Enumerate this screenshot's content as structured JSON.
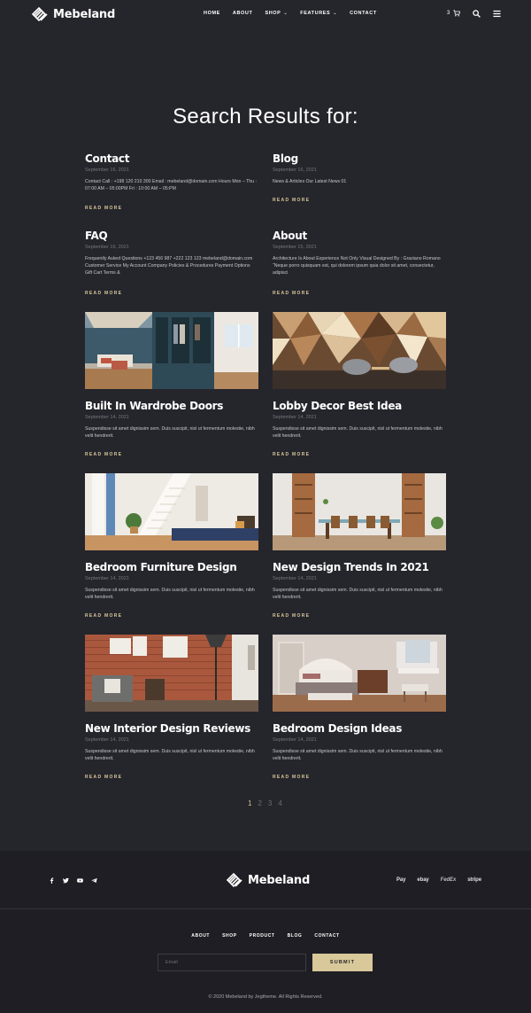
{
  "brand": {
    "name": "Mebeland"
  },
  "nav": {
    "items": [
      {
        "label": "HOME"
      },
      {
        "label": "ABOUT"
      },
      {
        "label": "SHOP",
        "dropdown": true
      },
      {
        "label": "FEATURES",
        "dropdown": true
      },
      {
        "label": "CONTACT"
      }
    ],
    "cart_count": "3"
  },
  "page": {
    "title": "Search Results for:"
  },
  "read_more_label": "READ MORE",
  "posts": [
    {
      "title": "Contact",
      "date": "September 16, 2021",
      "excerpt": "Contact Call : +198 120 210 300 Email : mebeland@domain.com Hours Mon – Thu : 07:00 AM – 05:00PM Fri : 10:00 AM – 05:PM"
    },
    {
      "title": "Blog",
      "date": "September 16, 2021",
      "excerpt": "News & Articles Our Latest News 01"
    },
    {
      "title": "FAQ",
      "date": "September 16, 2021",
      "excerpt": "Frequently Asked Questions +123 456 987 +222 123 123 mebeland@domain.com Customer Service My Account Company Policies & Procedures Payment Options Gift Cart Terms &"
    },
    {
      "title": "About",
      "date": "September 15, 2021",
      "excerpt": "Architecture Is About Experience Not Only Visual Designed By : Graziano Romano “Neque porro quisquam est, qui dolorem ipsum quia dolor sit amet, consectetur, adipisci"
    },
    {
      "title": "Built In Wardrobe Doors",
      "date": "September 14, 2021",
      "excerpt": "Suspendisse sit amet dignissim sem. Duis suscipit, nisl ut fermentum molestie, nibh velit hendrerit.",
      "image": "wardrobe-bedroom-photo"
    },
    {
      "title": "Lobby Decor Best Idea",
      "date": "September 14, 2021",
      "excerpt": "Suspendisse sit amet dignissim sem. Duis suscipit, nisl ut fermentum molestie, nibh velit hendrerit.",
      "image": "lobby-wood-wall-photo"
    },
    {
      "title": "Bedroom Furniture Design",
      "date": "September 14, 2021",
      "excerpt": "Suspendisse sit amet dignissim sem. Duis suscipit, nisl ut fermentum molestie, nibh velit hendrerit.",
      "image": "bedroom-stairs-photo"
    },
    {
      "title": "New Design Trends In 2021",
      "date": "September 14, 2021",
      "excerpt": "Suspendisse sit amet dignissim sem. Duis suscipit, nisl ut fermentum molestie, nibh velit hendrerit.",
      "image": "dining-room-photo"
    },
    {
      "title": "New Interior Design Reviews",
      "date": "September 14, 2021",
      "excerpt": "Suspendisse sit amet dignissim sem. Duis suscipit, nisl ut fermentum molestie, nibh velit hendrerit.",
      "image": "brick-wall-chair-photo"
    },
    {
      "title": "Bedroom Design Ideas",
      "date": "September 14, 2021",
      "excerpt": "Suspendisse sit amet dignissim sem. Duis suscipit, nisl ut fermentum molestie, nibh velit hendrerit.",
      "image": "classic-bedroom-photo"
    }
  ],
  "pagination": {
    "pages": [
      "1",
      "2",
      "3",
      "4"
    ],
    "current": "1"
  },
  "footer": {
    "social": [
      "facebook-icon",
      "twitter-icon",
      "youtube-icon",
      "telegram-icon"
    ],
    "payments": [
      "Pay",
      "ebay",
      "FedEx",
      "stripe"
    ],
    "nav": [
      "ABOUT",
      "SHOP",
      "PRODUCT",
      "BLOG",
      "CONTACT"
    ],
    "email_placeholder": "Email",
    "subscribe_label": "SUBMIT",
    "copyright": "© 2020 Mebeland by Jegtheme. All Rights Reserved."
  },
  "colors": {
    "background": "#25252c",
    "footer": "#1e1e24",
    "accent": "#d8c89a"
  }
}
